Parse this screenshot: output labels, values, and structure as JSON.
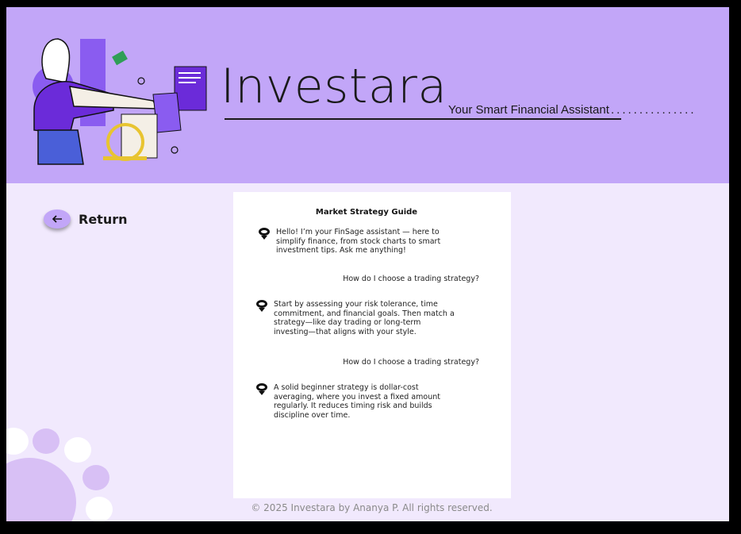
{
  "brand": {
    "title": "Investara",
    "tagline": "Your Smart Financial Assistant",
    "tagline_dots": "..............."
  },
  "nav": {
    "return_label": "Return"
  },
  "chat": {
    "title": "Market Strategy Guide",
    "messages": [
      {
        "role": "bot",
        "text": "Hello! I’m your FinSage assistant — here to simplify finance, from stock charts to smart investment tips. Ask me anything!"
      },
      {
        "role": "user",
        "text": "How do I choose a trading strategy?"
      },
      {
        "role": "bot",
        "text": "Start by assessing your risk tolerance, time commitment, and financial goals. Then match a strategy—like day trading or long-term investing—that aligns with your style."
      },
      {
        "role": "user",
        "text": "How do I choose a trading strategy?"
      },
      {
        "role": "bot",
        "text": "A solid beginner strategy is dollar-cost averaging, where you invest a fixed amount regularly. It reduces timing risk and builds discipline over time."
      }
    ]
  },
  "footer": {
    "text": "© 2025 Investara by Ananya P. All rights reserved."
  },
  "colors": {
    "header_bg": "#c2a6f8",
    "page_bg": "#f1e9fd",
    "accent_purple": "#7b3fe4",
    "dot_purple": "#d8c0f5"
  },
  "icons": {
    "return": "arrow-left-icon",
    "bot": "bot-avatar-icon"
  }
}
